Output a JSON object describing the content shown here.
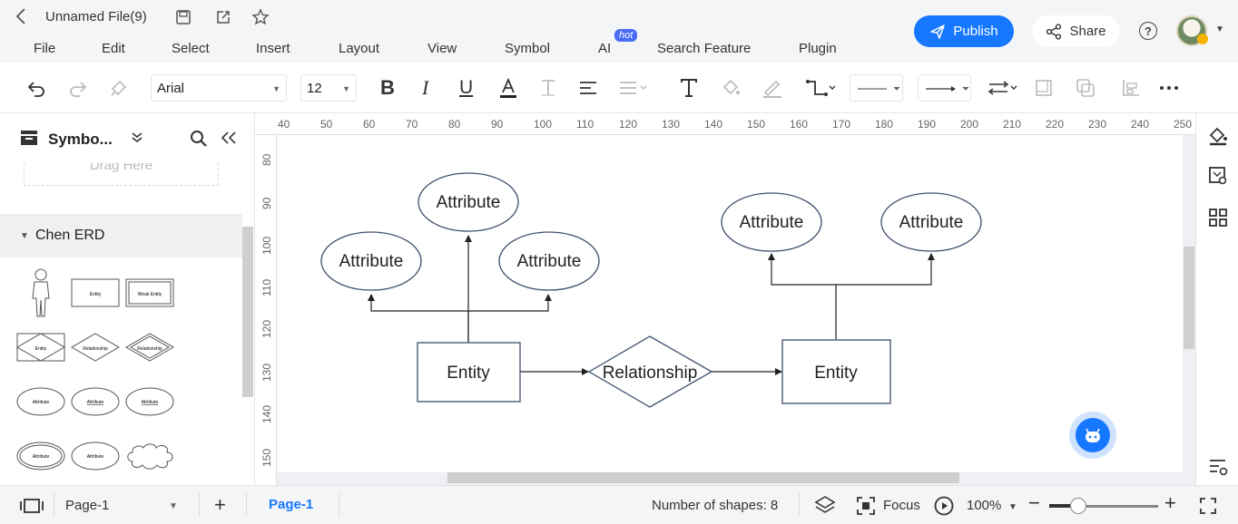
{
  "header": {
    "file_name": "Unnamed File(9)",
    "menu": [
      "File",
      "Edit",
      "Select",
      "Insert",
      "Layout",
      "View",
      "Symbol",
      "AI",
      "Search Feature",
      "Plugin"
    ],
    "hot_badge": "hot",
    "publish_label": "Publish",
    "share_label": "Share",
    "accent_color": "#1677ff"
  },
  "toolbar": {
    "font": "Arial",
    "font_size": "12"
  },
  "left_panel": {
    "title": "Symbo...",
    "drag_hint": "Drag Here",
    "category": "Chen ERD",
    "symbols": {
      "entity": "Entity",
      "weak_entity": "Weak Entity",
      "relationship": "Relationship",
      "attribute": "Attribute"
    }
  },
  "ruler": {
    "x_ticks": [
      "40",
      "50",
      "60",
      "70",
      "80",
      "90",
      "100",
      "110",
      "120",
      "130",
      "140",
      "150",
      "160",
      "170",
      "180",
      "190",
      "200",
      "210",
      "220",
      "230",
      "240",
      "250"
    ],
    "y_ticks": [
      "80",
      "90",
      "100",
      "110",
      "120",
      "130",
      "140",
      "150"
    ]
  },
  "diagram": {
    "attr_1": "Attribute",
    "attr_2": "Attribute",
    "attr_3": "Attribute",
    "attr_4": "Attribute",
    "attr_5": "Attribute",
    "entity_left": "Entity",
    "relationship": "Relationship",
    "entity_right": "Entity"
  },
  "status_bar": {
    "page_selector": "Page-1",
    "active_page": "Page-1",
    "shape_count": "Number of shapes: 8",
    "focus_label": "Focus",
    "zoom": "100%",
    "zoom_fraction": 0.27
  }
}
